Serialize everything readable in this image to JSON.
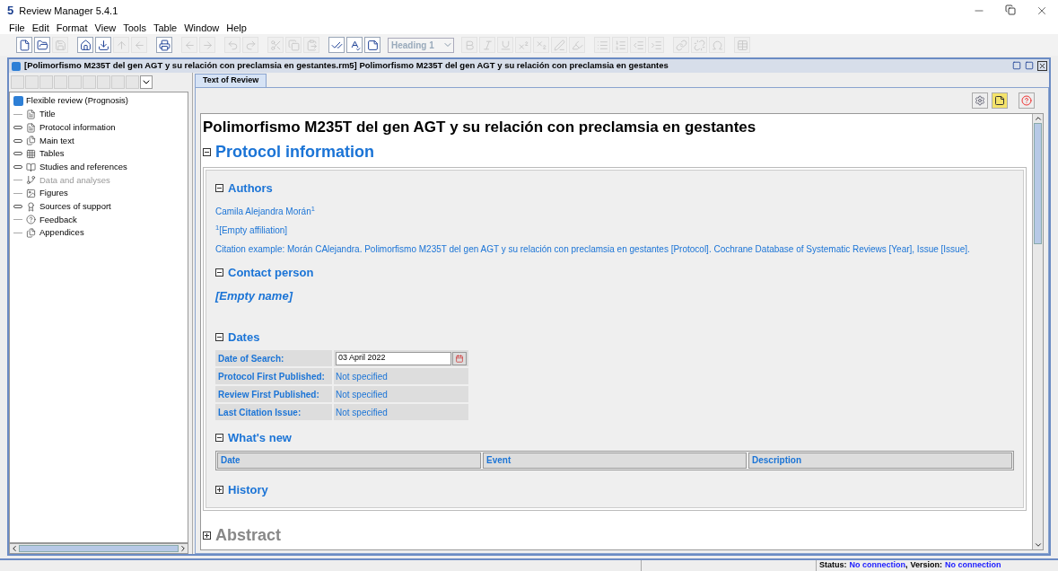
{
  "window": {
    "logo": "5",
    "title": "Review Manager 5.4.1"
  },
  "menu": [
    "File",
    "Edit",
    "Format",
    "View",
    "Tools",
    "Table",
    "Window",
    "Help"
  ],
  "toolbar": [
    {
      "kind": "new",
      "disabled": false
    },
    {
      "kind": "open",
      "disabled": false
    },
    {
      "kind": "save",
      "disabled": true
    },
    {
      "kind": "sep"
    },
    {
      "kind": "home",
      "disabled": false
    },
    {
      "kind": "import",
      "disabled": false
    },
    {
      "kind": "up",
      "disabled": true
    },
    {
      "kind": "back",
      "disabled": true
    },
    {
      "kind": "sep"
    },
    {
      "kind": "print",
      "disabled": false
    },
    {
      "kind": "sep"
    },
    {
      "kind": "left",
      "disabled": true
    },
    {
      "kind": "right",
      "disabled": true
    },
    {
      "kind": "sep"
    },
    {
      "kind": "undo",
      "disabled": true
    },
    {
      "kind": "redo",
      "disabled": true
    },
    {
      "kind": "sep"
    },
    {
      "kind": "cut",
      "disabled": true
    },
    {
      "kind": "copy",
      "disabled": true
    },
    {
      "kind": "paste",
      "disabled": true
    },
    {
      "kind": "sep"
    },
    {
      "kind": "check",
      "disabled": false
    },
    {
      "kind": "spell",
      "disabled": false
    },
    {
      "kind": "notes",
      "disabled": false
    },
    {
      "kind": "style"
    },
    {
      "kind": "bold",
      "disabled": true
    },
    {
      "kind": "italic",
      "disabled": true
    },
    {
      "kind": "underline",
      "disabled": true
    },
    {
      "kind": "sup",
      "disabled": true
    },
    {
      "kind": "sub",
      "disabled": true
    },
    {
      "kind": "pen",
      "disabled": true
    },
    {
      "kind": "mark",
      "disabled": true
    },
    {
      "kind": "sep"
    },
    {
      "kind": "list",
      "disabled": true
    },
    {
      "kind": "olist",
      "disabled": true
    },
    {
      "kind": "outdent",
      "disabled": true
    },
    {
      "kind": "indent",
      "disabled": true
    },
    {
      "kind": "sep"
    },
    {
      "kind": "link",
      "disabled": true
    },
    {
      "kind": "unlink",
      "disabled": true
    },
    {
      "kind": "omega",
      "disabled": true
    },
    {
      "kind": "sep"
    },
    {
      "kind": "table",
      "disabled": true
    }
  ],
  "style_dropdown": {
    "value": "Heading 1",
    "disabled": true
  },
  "document": {
    "title": "[Polimorfismo M235T del gen AGT y su relación con preclamsia en gestantes.rm5] Polimorfismo M235T del gen AGT y su relación con preclamsia en gestantes"
  },
  "sidebar": {
    "root": "Flexible review (Prognosis)",
    "items": [
      {
        "label": "Title",
        "kind": "leaf",
        "disabled": false
      },
      {
        "label": "Protocol information",
        "kind": "branch",
        "disabled": false
      },
      {
        "label": "Main text",
        "kind": "branch",
        "disabled": false
      },
      {
        "label": "Tables",
        "kind": "branch",
        "disabled": false
      },
      {
        "label": "Studies and references",
        "kind": "branch",
        "disabled": false
      },
      {
        "label": "Data and analyses",
        "kind": "leaf",
        "disabled": true
      },
      {
        "label": "Figures",
        "kind": "leaf",
        "disabled": false
      },
      {
        "label": "Sources of support",
        "kind": "branch",
        "disabled": false
      },
      {
        "label": "Feedback",
        "kind": "leaf",
        "disabled": false
      },
      {
        "label": "Appendices",
        "kind": "leaf",
        "disabled": false
      }
    ]
  },
  "tabs": [
    {
      "label": "Text of Review",
      "selected": true
    }
  ],
  "review": {
    "title": "Polimorfismo M235T del gen AGT y su relación con preclamsia en gestantes",
    "protocol": {
      "heading": "Protocol information",
      "expanded": true,
      "authors": {
        "heading": "Authors",
        "expanded": true,
        "name": "Camila Alejandra Morán$^{1}$",
        "affiliation": "$^{1}$[Empty affiliation]",
        "citation": "Citation example: Morán CAlejandra. Polimorfismo M235T del gen AGT y su relación con preclamsia en gestantes [Protocol]. Cochrane Database of Systematic Reviews [Year], Issue [Issue]."
      },
      "contact": {
        "heading": "Contact person",
        "expanded": true,
        "name": "[Empty name]"
      },
      "dates": {
        "heading": "Dates",
        "expanded": true,
        "rows": [
          {
            "label": "Date of Search:",
            "value": "03 April 2022",
            "kind": "date"
          },
          {
            "label": "Protocol First Published:",
            "value": "Not specified",
            "kind": "text"
          },
          {
            "label": "Review First Published:",
            "value": "Not specified",
            "kind": "text"
          },
          {
            "label": "Last Citation Issue:",
            "value": "Not specified",
            "kind": "text"
          }
        ]
      },
      "whats_new": {
        "heading": "What's new",
        "expanded": true,
        "columns": [
          "Date",
          "Event",
          "Description"
        ]
      },
      "history": {
        "heading": "History",
        "expanded": false
      }
    },
    "abstract": {
      "heading": "Abstract",
      "expanded": false
    }
  },
  "status_bar": {
    "status_label": "Status:",
    "status": "No connection",
    "separator": ",",
    "version_label": "Version:",
    "version": "No connection"
  }
}
